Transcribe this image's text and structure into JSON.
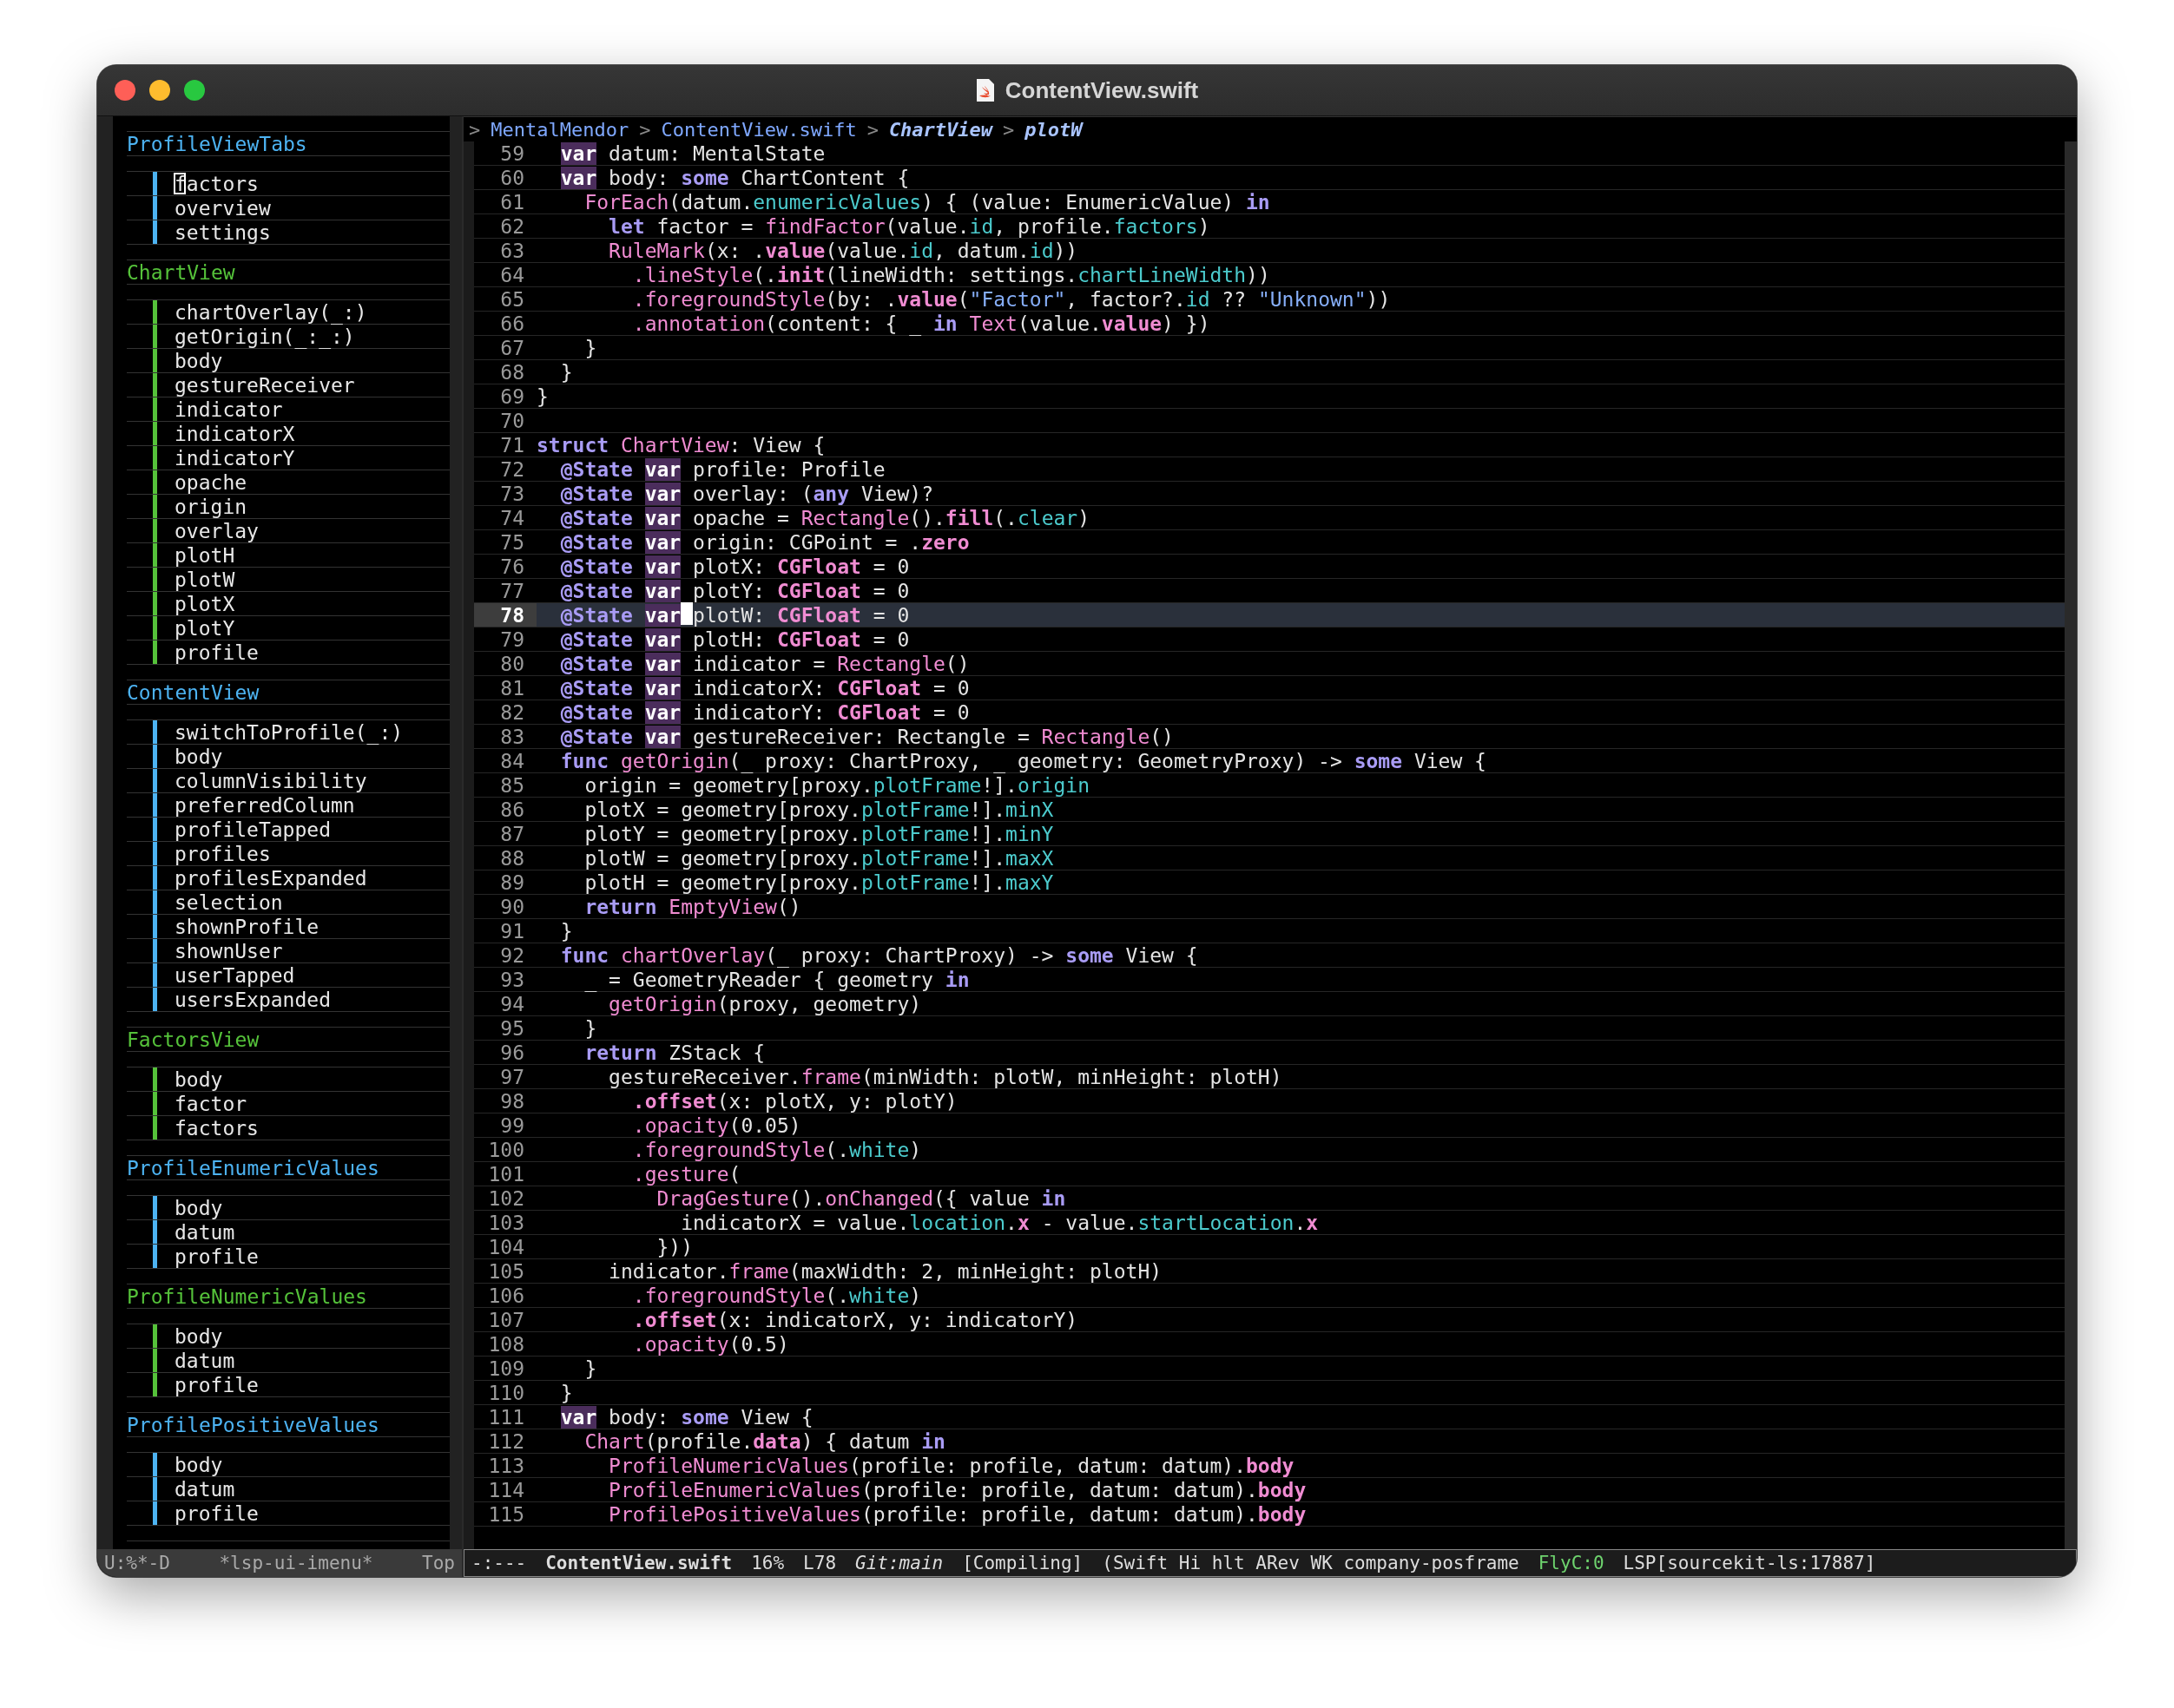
{
  "window": {
    "title": "ContentView.swift"
  },
  "sidebar": {
    "groups": [
      {
        "name": "ProfileViewTabs",
        "color": "#4db3f2",
        "items": [
          {
            "label": "factors",
            "cursor": true
          },
          {
            "label": "overview",
            "cursor": false
          },
          {
            "label": "settings",
            "cursor": false
          }
        ]
      },
      {
        "name": "ChartView",
        "color": "#55c23a",
        "items": [
          {
            "label": "chartOverlay(_:)",
            "cursor": false
          },
          {
            "label": "getOrigin(_:_:)",
            "cursor": false
          },
          {
            "label": "body",
            "cursor": false
          },
          {
            "label": "gestureReceiver",
            "cursor": false
          },
          {
            "label": "indicator",
            "cursor": false
          },
          {
            "label": "indicatorX",
            "cursor": false
          },
          {
            "label": "indicatorY",
            "cursor": false
          },
          {
            "label": "opache",
            "cursor": false
          },
          {
            "label": "origin",
            "cursor": false
          },
          {
            "label": "overlay",
            "cursor": false
          },
          {
            "label": "plotH",
            "cursor": false
          },
          {
            "label": "plotW",
            "cursor": false
          },
          {
            "label": "plotX",
            "cursor": false
          },
          {
            "label": "plotY",
            "cursor": false
          },
          {
            "label": "profile",
            "cursor": false
          }
        ]
      },
      {
        "name": "ContentView",
        "color": "#4db3f2",
        "items": [
          {
            "label": "switchToProfile(_:)",
            "cursor": false
          },
          {
            "label": "body",
            "cursor": false
          },
          {
            "label": "columnVisibility",
            "cursor": false
          },
          {
            "label": "preferredColumn",
            "cursor": false
          },
          {
            "label": "profileTapped",
            "cursor": false
          },
          {
            "label": "profiles",
            "cursor": false
          },
          {
            "label": "profilesExpanded",
            "cursor": false
          },
          {
            "label": "selection",
            "cursor": false
          },
          {
            "label": "shownProfile",
            "cursor": false
          },
          {
            "label": "shownUser",
            "cursor": false
          },
          {
            "label": "userTapped",
            "cursor": false
          },
          {
            "label": "usersExpanded",
            "cursor": false
          }
        ]
      },
      {
        "name": "FactorsView",
        "color": "#55c23a",
        "items": [
          {
            "label": "body",
            "cursor": false
          },
          {
            "label": "factor",
            "cursor": false
          },
          {
            "label": "factors",
            "cursor": false
          }
        ]
      },
      {
        "name": "ProfileEnumericValues",
        "color": "#4db3f2",
        "items": [
          {
            "label": "body",
            "cursor": false
          },
          {
            "label": "datum",
            "cursor": false
          },
          {
            "label": "profile",
            "cursor": false
          }
        ]
      },
      {
        "name": "ProfileNumericValues",
        "color": "#55c23a",
        "items": [
          {
            "label": "body",
            "cursor": false
          },
          {
            "label": "datum",
            "cursor": false
          },
          {
            "label": "profile",
            "cursor": false
          }
        ]
      },
      {
        "name": "ProfilePositiveValues",
        "color": "#4db3f2",
        "items": [
          {
            "label": "body",
            "cursor": false
          },
          {
            "label": "datum",
            "cursor": false
          },
          {
            "label": "profile",
            "cursor": false
          }
        ]
      }
    ],
    "mode_line": [
      {
        "kind": "plain",
        "text": "U:%*-D"
      },
      {
        "kind": "plain",
        "text": "*lsp-ui-imenu*"
      },
      {
        "kind": "plain",
        "text": "Top"
      }
    ]
  },
  "breadcrumb": [
    {
      "kind": "sep",
      "text": ">"
    },
    {
      "kind": "plain",
      "text": "MentalMendor"
    },
    {
      "kind": "sep",
      "text": ">"
    },
    {
      "kind": "plain",
      "text": "ContentView.swift"
    },
    {
      "kind": "sep",
      "text": ">"
    },
    {
      "kind": "italic",
      "text": "ChartView"
    },
    {
      "kind": "sep",
      "text": ">"
    },
    {
      "kind": "italic",
      "text": "plotW"
    }
  ],
  "editor": {
    "lines": [
      {
        "number": "59",
        "current": false,
        "tokens": [
          {
            "kind": "var",
            "text": "  var"
          },
          {
            "kind": "txt",
            "text": " datum: MentalState"
          }
        ]
      },
      {
        "number": "60",
        "current": false,
        "tokens": [
          {
            "kind": "var",
            "text": "  var"
          },
          {
            "kind": "txt",
            "text": " body: "
          },
          {
            "kind": "kw",
            "text": "some"
          },
          {
            "kind": "txt",
            "text": " ChartContent {"
          }
        ]
      },
      {
        "number": "61",
        "current": false,
        "tokens": [
          {
            "kind": "fn",
            "text": "    ForEach"
          },
          {
            "kind": "txt",
            "text": "(datum."
          },
          {
            "kind": "mem",
            "text": "enumericValues"
          },
          {
            "kind": "txt",
            "text": ") { (value: EnumericValue) "
          },
          {
            "kind": "kw",
            "text": "in"
          }
        ]
      },
      {
        "number": "62",
        "current": false,
        "tokens": [
          {
            "kind": "kw",
            "text": "      let"
          },
          {
            "kind": "txt",
            "text": " factor = "
          },
          {
            "kind": "fn",
            "text": "findFactor"
          },
          {
            "kind": "txt",
            "text": "(value."
          },
          {
            "kind": "mem",
            "text": "id"
          },
          {
            "kind": "txt",
            "text": ", profile."
          },
          {
            "kind": "mem",
            "text": "factors"
          },
          {
            "kind": "txt",
            "text": ")"
          }
        ]
      },
      {
        "number": "63",
        "current": false,
        "tokens": [
          {
            "kind": "fn",
            "text": "      RuleMark"
          },
          {
            "kind": "txt",
            "text": "(x: ."
          },
          {
            "kind": "fnb",
            "text": "value"
          },
          {
            "kind": "txt",
            "text": "(value."
          },
          {
            "kind": "mem",
            "text": "id"
          },
          {
            "kind": "txt",
            "text": ", datum."
          },
          {
            "kind": "mem",
            "text": "id"
          },
          {
            "kind": "txt",
            "text": "))"
          }
        ]
      },
      {
        "number": "64",
        "current": false,
        "tokens": [
          {
            "kind": "fn",
            "text": "        .lineStyle"
          },
          {
            "kind": "txt",
            "text": "(."
          },
          {
            "kind": "fnb",
            "text": "init"
          },
          {
            "kind": "txt",
            "text": "(lineWidth: settings."
          },
          {
            "kind": "mem",
            "text": "chartLineWidth"
          },
          {
            "kind": "txt",
            "text": "))"
          }
        ]
      },
      {
        "number": "65",
        "current": false,
        "tokens": [
          {
            "kind": "fn",
            "text": "        .foregroundStyle"
          },
          {
            "kind": "txt",
            "text": "(by: ."
          },
          {
            "kind": "fnb",
            "text": "value"
          },
          {
            "kind": "txt",
            "text": "("
          },
          {
            "kind": "str",
            "text": "\"Factor\""
          },
          {
            "kind": "txt",
            "text": ", factor?."
          },
          {
            "kind": "mem",
            "text": "id"
          },
          {
            "kind": "txt",
            "text": " ?? "
          },
          {
            "kind": "str",
            "text": "\"Unknown\""
          },
          {
            "kind": "txt",
            "text": "))"
          }
        ]
      },
      {
        "number": "66",
        "current": false,
        "tokens": [
          {
            "kind": "fn",
            "text": "        .annotation"
          },
          {
            "kind": "txt",
            "text": "(content: { _ "
          },
          {
            "kind": "kw",
            "text": "in "
          },
          {
            "kind": "fn",
            "text": "Text"
          },
          {
            "kind": "txt",
            "text": "(value."
          },
          {
            "kind": "fnb",
            "text": "value"
          },
          {
            "kind": "txt",
            "text": ") })"
          }
        ]
      },
      {
        "number": "67",
        "current": false,
        "tokens": [
          {
            "kind": "txt",
            "text": "    }"
          }
        ]
      },
      {
        "number": "68",
        "current": false,
        "tokens": [
          {
            "kind": "txt",
            "text": "  }"
          }
        ]
      },
      {
        "number": "69",
        "current": false,
        "tokens": [
          {
            "kind": "txt",
            "text": "}"
          }
        ]
      },
      {
        "number": "70",
        "current": false
      },
      {
        "number": "71",
        "current": false,
        "tokens": [
          {
            "kind": "kw",
            "text": "struct "
          },
          {
            "kind": "fn",
            "text": "ChartView"
          },
          {
            "kind": "txt",
            "text": ": View {"
          }
        ]
      },
      {
        "number": "72",
        "current": false,
        "tokens": [
          {
            "kind": "kw",
            "text": "  @State "
          },
          {
            "kind": "var",
            "text": "var"
          },
          {
            "kind": "txt",
            "text": " profile: Profile"
          }
        ]
      },
      {
        "number": "73",
        "current": false,
        "tokens": [
          {
            "kind": "kw",
            "text": "  @State "
          },
          {
            "kind": "var",
            "text": "var"
          },
          {
            "kind": "txt",
            "text": " overlay: ("
          },
          {
            "kind": "kw",
            "text": "any"
          },
          {
            "kind": "txt",
            "text": " View)?"
          }
        ]
      },
      {
        "number": "74",
        "current": false,
        "tokens": [
          {
            "kind": "kw",
            "text": "  @State "
          },
          {
            "kind": "var",
            "text": "var"
          },
          {
            "kind": "txt",
            "text": " opache = "
          },
          {
            "kind": "fn",
            "text": "Rectangle"
          },
          {
            "kind": "txt",
            "text": "()."
          },
          {
            "kind": "fnb",
            "text": "fill"
          },
          {
            "kind": "txt",
            "text": "(."
          },
          {
            "kind": "mem",
            "text": "clear"
          },
          {
            "kind": "txt",
            "text": ")"
          }
        ]
      },
      {
        "number": "75",
        "current": false,
        "tokens": [
          {
            "kind": "kw",
            "text": "  @State "
          },
          {
            "kind": "var",
            "text": "var"
          },
          {
            "kind": "txt",
            "text": " origin: CGPoint = ."
          },
          {
            "kind": "fnb",
            "text": "zero"
          }
        ]
      },
      {
        "number": "76",
        "current": false,
        "tokens": [
          {
            "kind": "kw",
            "text": "  @State "
          },
          {
            "kind": "var",
            "text": "var"
          },
          {
            "kind": "txt",
            "text": " plotX: "
          },
          {
            "kind": "fnb",
            "text": "CGFloat"
          },
          {
            "kind": "txt",
            "text": " = 0"
          }
        ]
      },
      {
        "number": "77",
        "current": false,
        "tokens": [
          {
            "kind": "kw",
            "text": "  @State "
          },
          {
            "kind": "var",
            "text": "var"
          },
          {
            "kind": "txt",
            "text": " plotY: "
          },
          {
            "kind": "fnb",
            "text": "CGFloat"
          },
          {
            "kind": "txt",
            "text": " = 0"
          }
        ]
      },
      {
        "number": "78",
        "current": true,
        "tokens": [
          {
            "kind": "kw",
            "text": "  @State "
          },
          {
            "kind": "var",
            "text": "var"
          },
          {
            "kind": "txt",
            "text": " plotW: ",
            "cursor": true
          },
          {
            "kind": "fnb",
            "text": "CGFloat"
          },
          {
            "kind": "txt",
            "text": " = 0"
          }
        ]
      },
      {
        "number": "79",
        "current": false,
        "tokens": [
          {
            "kind": "kw",
            "text": "  @State "
          },
          {
            "kind": "var",
            "text": "var"
          },
          {
            "kind": "txt",
            "text": " plotH: "
          },
          {
            "kind": "fnb",
            "text": "CGFloat"
          },
          {
            "kind": "txt",
            "text": " = 0"
          }
        ]
      },
      {
        "number": "80",
        "current": false,
        "tokens": [
          {
            "kind": "kw",
            "text": "  @State "
          },
          {
            "kind": "var",
            "text": "var"
          },
          {
            "kind": "txt",
            "text": " indicator = "
          },
          {
            "kind": "fn",
            "text": "Rectangle"
          },
          {
            "kind": "txt",
            "text": "()"
          }
        ]
      },
      {
        "number": "81",
        "current": false,
        "tokens": [
          {
            "kind": "kw",
            "text": "  @State "
          },
          {
            "kind": "var",
            "text": "var"
          },
          {
            "kind": "txt",
            "text": " indicatorX: "
          },
          {
            "kind": "fnb",
            "text": "CGFloat"
          },
          {
            "kind": "txt",
            "text": " = 0"
          }
        ]
      },
      {
        "number": "82",
        "current": false,
        "tokens": [
          {
            "kind": "kw",
            "text": "  @State "
          },
          {
            "kind": "var",
            "text": "var"
          },
          {
            "kind": "txt",
            "text": " indicatorY: "
          },
          {
            "kind": "fnb",
            "text": "CGFloat"
          },
          {
            "kind": "txt",
            "text": " = 0"
          }
        ]
      },
      {
        "number": "83",
        "current": false,
        "tokens": [
          {
            "kind": "kw",
            "text": "  @State "
          },
          {
            "kind": "var",
            "text": "var"
          },
          {
            "kind": "txt",
            "text": " gestureReceiver: Rectangle = "
          },
          {
            "kind": "fn",
            "text": "Rectangle"
          },
          {
            "kind": "txt",
            "text": "()"
          }
        ]
      },
      {
        "number": "84",
        "current": false,
        "tokens": [
          {
            "kind": "kw",
            "text": "  func "
          },
          {
            "kind": "fn",
            "text": "getOrigin"
          },
          {
            "kind": "txt",
            "text": "(_ proxy: ChartProxy, _ geometry: GeometryProxy) -> "
          },
          {
            "kind": "kw",
            "text": "some"
          },
          {
            "kind": "txt",
            "text": " View {"
          }
        ]
      },
      {
        "number": "85",
        "current": false,
        "tokens": [
          {
            "kind": "txt",
            "text": "    origin = geometry[proxy."
          },
          {
            "kind": "mem",
            "text": "plotFrame"
          },
          {
            "kind": "txt",
            "text": "!]."
          },
          {
            "kind": "mem",
            "text": "origin"
          }
        ]
      },
      {
        "number": "86",
        "current": false,
        "tokens": [
          {
            "kind": "txt",
            "text": "    plotX = geometry[proxy."
          },
          {
            "kind": "mem",
            "text": "plotFrame"
          },
          {
            "kind": "txt",
            "text": "!]."
          },
          {
            "kind": "mem",
            "text": "minX"
          }
        ]
      },
      {
        "number": "87",
        "current": false,
        "tokens": [
          {
            "kind": "txt",
            "text": "    plotY = geometry[proxy."
          },
          {
            "kind": "mem",
            "text": "plotFrame"
          },
          {
            "kind": "txt",
            "text": "!]."
          },
          {
            "kind": "mem",
            "text": "minY"
          }
        ]
      },
      {
        "number": "88",
        "current": false,
        "tokens": [
          {
            "kind": "txt",
            "text": "    plotW = geometry[proxy."
          },
          {
            "kind": "mem",
            "text": "plotFrame"
          },
          {
            "kind": "txt",
            "text": "!]."
          },
          {
            "kind": "mem",
            "text": "maxX"
          }
        ]
      },
      {
        "number": "89",
        "current": false,
        "tokens": [
          {
            "kind": "txt",
            "text": "    plotH = geometry[proxy."
          },
          {
            "kind": "mem",
            "text": "plotFrame"
          },
          {
            "kind": "txt",
            "text": "!]."
          },
          {
            "kind": "mem",
            "text": "maxY"
          }
        ]
      },
      {
        "number": "90",
        "current": false,
        "tokens": [
          {
            "kind": "kw",
            "text": "    return "
          },
          {
            "kind": "fn",
            "text": "EmptyView"
          },
          {
            "kind": "txt",
            "text": "()"
          }
        ]
      },
      {
        "number": "91",
        "current": false,
        "tokens": [
          {
            "kind": "txt",
            "text": "  }"
          }
        ]
      },
      {
        "number": "92",
        "current": false,
        "tokens": [
          {
            "kind": "kw",
            "text": "  func "
          },
          {
            "kind": "fn",
            "text": "chartOverlay"
          },
          {
            "kind": "txt",
            "text": "(_ proxy: ChartProxy) -> "
          },
          {
            "kind": "kw",
            "text": "some"
          },
          {
            "kind": "txt",
            "text": " View {"
          }
        ]
      },
      {
        "number": "93",
        "current": false,
        "tokens": [
          {
            "kind": "txt",
            "text": "    _ = GeometryReader { geometry "
          },
          {
            "kind": "kw",
            "text": "in"
          }
        ]
      },
      {
        "number": "94",
        "current": false,
        "tokens": [
          {
            "kind": "fn",
            "text": "      getOrigin"
          },
          {
            "kind": "txt",
            "text": "(proxy, geometry)"
          }
        ]
      },
      {
        "number": "95",
        "current": false,
        "tokens": [
          {
            "kind": "txt",
            "text": "    }"
          }
        ]
      },
      {
        "number": "96",
        "current": false,
        "tokens": [
          {
            "kind": "kw",
            "text": "    return"
          },
          {
            "kind": "txt",
            "text": " ZStack {"
          }
        ]
      },
      {
        "number": "97",
        "current": false,
        "tokens": [
          {
            "kind": "txt",
            "text": "      gestureReceiver."
          },
          {
            "kind": "fn",
            "text": "frame"
          },
          {
            "kind": "txt",
            "text": "(minWidth: plotW, minHeight: plotH)"
          }
        ]
      },
      {
        "number": "98",
        "current": false,
        "tokens": [
          {
            "kind": "fnb",
            "text": "        .offset"
          },
          {
            "kind": "txt",
            "text": "(x: plotX, y: plotY)"
          }
        ]
      },
      {
        "number": "99",
        "current": false,
        "tokens": [
          {
            "kind": "fn",
            "text": "        .opacity"
          },
          {
            "kind": "txt",
            "text": "(0.05)"
          }
        ]
      },
      {
        "number": "100",
        "current": false,
        "tokens": [
          {
            "kind": "fn",
            "text": "        .foregroundStyle"
          },
          {
            "kind": "txt",
            "text": "(."
          },
          {
            "kind": "mem",
            "text": "white"
          },
          {
            "kind": "txt",
            "text": ")"
          }
        ]
      },
      {
        "number": "101",
        "current": false,
        "tokens": [
          {
            "kind": "fn",
            "text": "        .gesture"
          },
          {
            "kind": "txt",
            "text": "("
          }
        ]
      },
      {
        "number": "102",
        "current": false,
        "tokens": [
          {
            "kind": "fn",
            "text": "          DragGesture"
          },
          {
            "kind": "txt",
            "text": "()."
          },
          {
            "kind": "fn",
            "text": "onChanged"
          },
          {
            "kind": "txt",
            "text": "({ value "
          },
          {
            "kind": "kw",
            "text": "in"
          }
        ]
      },
      {
        "number": "103",
        "current": false,
        "tokens": [
          {
            "kind": "txt",
            "text": "            indicatorX = value."
          },
          {
            "kind": "mem",
            "text": "location"
          },
          {
            "kind": "txt",
            "text": "."
          },
          {
            "kind": "fnb",
            "text": "x"
          },
          {
            "kind": "txt",
            "text": " - value."
          },
          {
            "kind": "mem",
            "text": "startLocation"
          },
          {
            "kind": "txt",
            "text": "."
          },
          {
            "kind": "fnb",
            "text": "x"
          }
        ]
      },
      {
        "number": "104",
        "current": false,
        "tokens": [
          {
            "kind": "txt",
            "text": "          }))"
          }
        ]
      },
      {
        "number": "105",
        "current": false,
        "tokens": [
          {
            "kind": "txt",
            "text": "      indicator."
          },
          {
            "kind": "fn",
            "text": "frame"
          },
          {
            "kind": "txt",
            "text": "(maxWidth: 2, minHeight: plotH)"
          }
        ]
      },
      {
        "number": "106",
        "current": false,
        "tokens": [
          {
            "kind": "fn",
            "text": "        .foregroundStyle"
          },
          {
            "kind": "txt",
            "text": "(."
          },
          {
            "kind": "mem",
            "text": "white"
          },
          {
            "kind": "txt",
            "text": ")"
          }
        ]
      },
      {
        "number": "107",
        "current": false,
        "tokens": [
          {
            "kind": "fnb",
            "text": "        .offset"
          },
          {
            "kind": "txt",
            "text": "(x: indicatorX, y: indicatorY)"
          }
        ]
      },
      {
        "number": "108",
        "current": false,
        "tokens": [
          {
            "kind": "fn",
            "text": "        .opacity"
          },
          {
            "kind": "txt",
            "text": "(0.5)"
          }
        ]
      },
      {
        "number": "109",
        "current": false,
        "tokens": [
          {
            "kind": "txt",
            "text": "    }"
          }
        ]
      },
      {
        "number": "110",
        "current": false,
        "tokens": [
          {
            "kind": "txt",
            "text": "  }"
          }
        ]
      },
      {
        "number": "111",
        "current": false,
        "tokens": [
          {
            "kind": "var",
            "text": "  var"
          },
          {
            "kind": "txt",
            "text": " body: "
          },
          {
            "kind": "kw",
            "text": "some"
          },
          {
            "kind": "txt",
            "text": " View {"
          }
        ]
      },
      {
        "number": "112",
        "current": false,
        "tokens": [
          {
            "kind": "fn",
            "text": "    Chart"
          },
          {
            "kind": "txt",
            "text": "(profile."
          },
          {
            "kind": "fnb",
            "text": "data"
          },
          {
            "kind": "txt",
            "text": ") { datum "
          },
          {
            "kind": "kw",
            "text": "in"
          }
        ]
      },
      {
        "number": "113",
        "current": false,
        "tokens": [
          {
            "kind": "fn",
            "text": "      ProfileNumericValues"
          },
          {
            "kind": "txt",
            "text": "(profile: profile, datum: datum)."
          },
          {
            "kind": "fnb",
            "text": "body"
          }
        ]
      },
      {
        "number": "114",
        "current": false,
        "tokens": [
          {
            "kind": "fn",
            "text": "      ProfileEnumericValues"
          },
          {
            "kind": "txt",
            "text": "(profile: profile, datum: datum)."
          },
          {
            "kind": "fnb",
            "text": "body"
          }
        ]
      },
      {
        "number": "115",
        "current": false,
        "tokens": [
          {
            "kind": "fn",
            "text": "      ProfilePositiveValues"
          },
          {
            "kind": "txt",
            "text": "(profile: profile, datum: datum)."
          },
          {
            "kind": "fnb",
            "text": "body"
          }
        ]
      }
    ],
    "mode_line": [
      {
        "kind": "plain",
        "text": "-:---"
      },
      {
        "kind": "bold",
        "text": "ContentView.swift"
      },
      {
        "kind": "plain",
        "text": "16%"
      },
      {
        "kind": "plain",
        "text": "L78"
      },
      {
        "kind": "italic",
        "text": "Git:main"
      },
      {
        "kind": "plain",
        "text": "[Compiling]"
      },
      {
        "kind": "plain",
        "text": "(Swift Hi hlt ARev WK company-posframe"
      },
      {
        "kind": "green",
        "text": "FlyC:0"
      },
      {
        "kind": "plain",
        "text": "LSP[sourcekit-ls:17887]"
      }
    ]
  }
}
